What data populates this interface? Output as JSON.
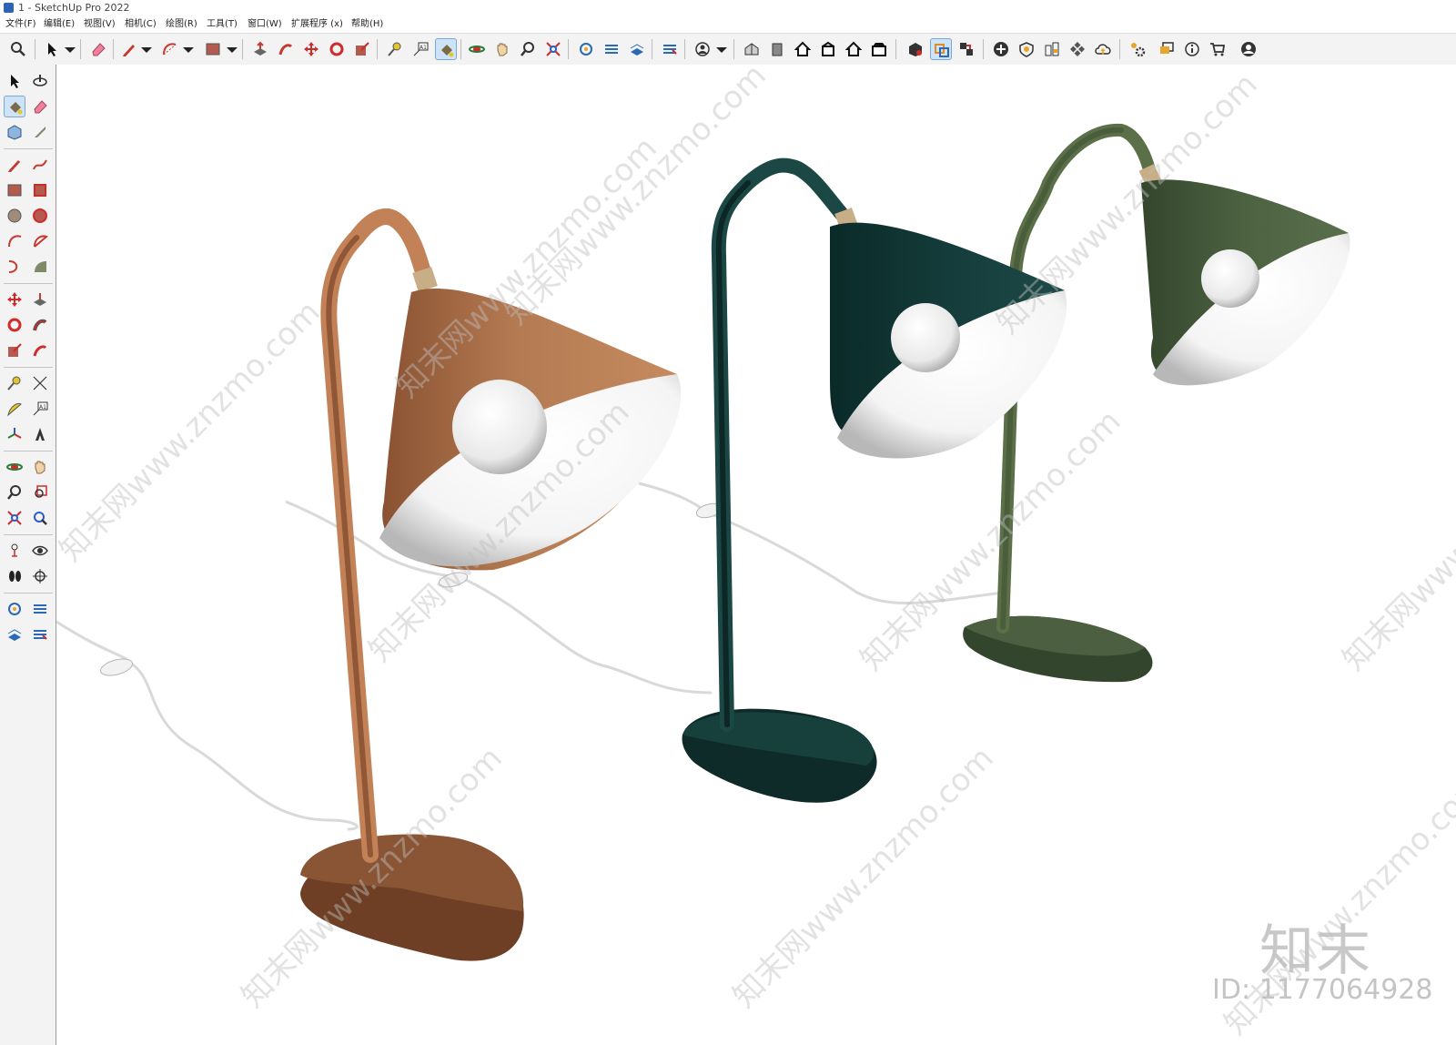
{
  "window": {
    "title": "1 - SketchUp Pro 2022"
  },
  "menu": [
    "文件(F)",
    "编辑(E)",
    "视图(V)",
    "相机(C)",
    "绘图(R)",
    "工具(T)",
    "窗口(W)",
    "扩展程序 (x)",
    "帮助(H)"
  ],
  "toolbar": {
    "items": [
      "zoom-icon",
      "select-icon",
      "eraser-icon",
      "pencil-icon",
      "arc-icon",
      "rectangle-icon",
      "push-pull-icon",
      "follow-me-icon",
      "move-icon",
      "rotate-icon",
      "scale-icon",
      "tape-measure-icon",
      "text-icon",
      "paint-bucket-icon",
      "orbit-icon",
      "pan-icon",
      "zoom-window-icon",
      "zoom-extents-icon",
      "section-plane-icon",
      "section-display-icon",
      "section-cuts-icon",
      "fill-icon",
      "user-icon",
      "iso-view-icon",
      "front-view-icon",
      "home-view-icon",
      "right-view-icon",
      "back-view-icon",
      "left-view-icon",
      "components-icon",
      "materials-icon",
      "layers-icon",
      "add-icon",
      "shield-icon",
      "warehouse-icon",
      "checker-icon",
      "cloud-icon",
      "settings-icon",
      "chat-icon",
      "info-icon",
      "cart-icon",
      "account-icon"
    ]
  },
  "lefttools": [
    "select-icon",
    "orbit-icon",
    "paint-icon",
    "eraser-icon",
    "component-icon",
    "tape-icon",
    "line-icon",
    "freehand-icon",
    "rect-icon",
    "rotated-rect-icon",
    "circle-icon",
    "polygon-icon",
    "arc-icon",
    "pie-icon",
    "arc3-icon",
    "pie2-icon",
    "move-icon",
    "push-pull-icon",
    "rotate-icon",
    "follow-me-icon",
    "scale-icon",
    "offset-icon",
    "tape-measure-icon",
    "dimension-icon",
    "protractor-icon",
    "text-icon",
    "axes-icon",
    "3d-text-icon",
    "orbit2-icon",
    "pan-icon",
    "zoom-icon",
    "zoom-window-icon",
    "zoom-extents-icon",
    "previous-icon",
    "position-camera-icon",
    "look-around-icon",
    "walk-icon",
    "section-icon",
    "section-plane-icon",
    "section-display-icon",
    "section-fill-icon",
    "section-cuts-icon"
  ],
  "watermark": {
    "text": "知末网www.znzmo.com",
    "brand": "知末",
    "id": "ID: 1177064928"
  },
  "colors": {
    "lamp1": "#b0714b",
    "lamp2": "#133a38",
    "lamp3": "#4a5e3f",
    "joint": "#c8ae87"
  }
}
